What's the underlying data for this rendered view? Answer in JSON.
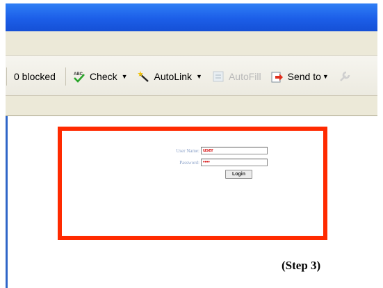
{
  "toolbar": {
    "blocked_label": "0 blocked",
    "check_label": "Check",
    "autolink_label": "AutoLink",
    "autofill_label": "AutoFill",
    "sendto_label": "Send to",
    "icons": [
      "spellcheck-icon",
      "wand-icon",
      "form-icon",
      "sendto-icon",
      "wrench-icon"
    ]
  },
  "login": {
    "username_label": "User Name:",
    "username_value": "user",
    "password_label": "Password:",
    "password_value": "••••",
    "login_button": "Login"
  },
  "caption": "(Step 3)",
  "colors": {
    "titlebar": "#1c5ee8",
    "highlight": "#ff2a00",
    "field_text": "#d40000"
  }
}
